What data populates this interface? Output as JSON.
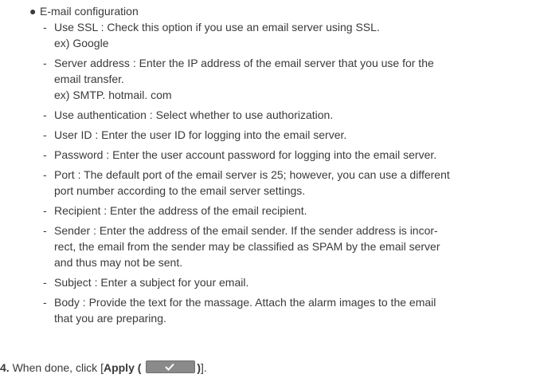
{
  "section": {
    "title": "E-mail configuration",
    "items": [
      {
        "lines": [
          "Use SSL : Check this option if you use an email server using SSL.",
          "ex) Google"
        ]
      },
      {
        "lines": [
          "Server address : Enter the IP address of the email server that you use for the",
          "email transfer.",
          "ex) SMTP. hotmail. com"
        ]
      },
      {
        "lines": [
          "Use authentication : Select whether to use authorization."
        ]
      },
      {
        "lines": [
          "User ID : Enter the user ID for logging into the email server."
        ]
      },
      {
        "lines": [
          "Password : Enter the user account password for logging into the email server."
        ]
      },
      {
        "lines": [
          "Port : The default port of the email server is 25; however, you can use a different",
          "port number according to the email server settings."
        ]
      },
      {
        "lines": [
          "Recipient : Enter the address of the email recipient."
        ]
      },
      {
        "lines": [
          "Sender : Enter the address of the email sender. If the sender address is incor-",
          "rect, the email from the sender may be classified as SPAM by the email server",
          "and thus may not be sent."
        ]
      },
      {
        "lines": [
          "Subject : Enter a subject for your email."
        ]
      },
      {
        "lines": [
          "Body : Provide the text for the massage. Attach the alarm images to the email",
          "that you are preparing."
        ]
      }
    ]
  },
  "step": {
    "number": "4.",
    "text": "When done, click [",
    "apply_label": "Apply (",
    "after_icon": ")",
    "close": "]."
  },
  "icons": {
    "apply_check": "check-icon"
  },
  "colors": {
    "text": "#3a3a3a",
    "apply_button": "#8a8a8a"
  }
}
